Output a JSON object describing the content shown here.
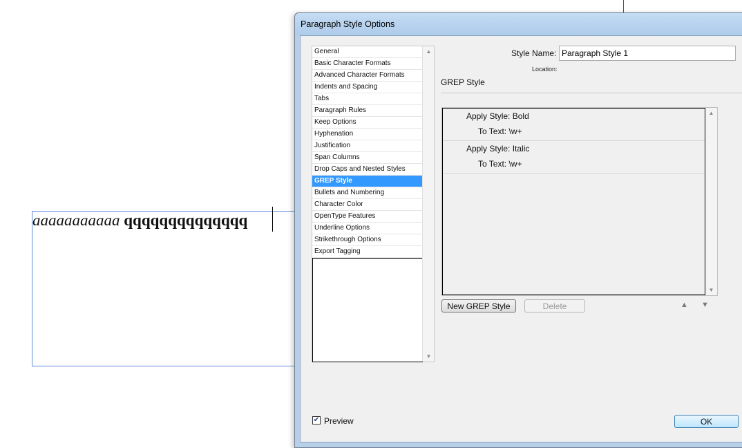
{
  "document": {
    "text_italic": "aaaaaaaaaaa",
    "text_bold": "qqqqqqqqqqqqqq"
  },
  "dialog": {
    "title": "Paragraph Style Options",
    "categories": [
      "General",
      "Basic Character Formats",
      "Advanced Character Formats",
      "Indents and Spacing",
      "Tabs",
      "Paragraph Rules",
      "Keep Options",
      "Hyphenation",
      "Justification",
      "Span Columns",
      "Drop Caps and Nested Styles",
      "GREP Style",
      "Bullets and Numbering",
      "Character Color",
      "OpenType Features",
      "Underline Options",
      "Strikethrough Options",
      "Export Tagging"
    ],
    "selected_category": "GREP Style",
    "style_name_label": "Style Name:",
    "style_name_value": "Paragraph Style 1",
    "location_label": "Location:",
    "section_title": "GREP Style",
    "grep_styles": [
      {
        "apply_label": "Apply Style:",
        "apply_value": "Bold",
        "to_label": "To Text:",
        "to_value": "\\w+"
      },
      {
        "apply_label": "Apply Style:",
        "apply_value": "Italic",
        "to_label": "To Text:",
        "to_value": "\\w+"
      }
    ],
    "new_grep_button": "New GREP Style",
    "delete_button": "Delete",
    "preview_label": "Preview",
    "preview_checked": true,
    "ok_button": "OK"
  },
  "icons": {
    "scroll_up": "triangle-up-icon",
    "scroll_down": "triangle-down-icon",
    "move_up": "move-up-icon",
    "move_down": "move-down-icon",
    "checkmark": "checkmark-icon"
  },
  "colors": {
    "selection": "#3399ff",
    "frame_border": "#5b8ad8",
    "titlebar": "#b8cfe8"
  }
}
